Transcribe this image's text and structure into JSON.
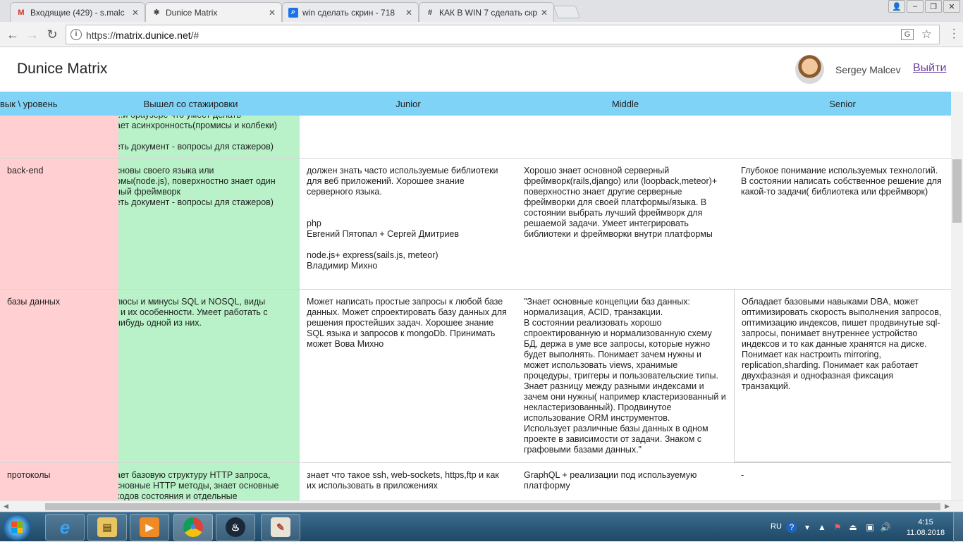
{
  "browser": {
    "tabs": [
      {
        "title": "Входящие (429) - s.malc",
        "icon": "gmail-icon",
        "active": false
      },
      {
        "title": "Dunice Matrix",
        "icon": "react-icon",
        "active": true
      },
      {
        "title": "win сделать скрин - 718",
        "icon": "search-icon",
        "active": false
      },
      {
        "title": "КАК В WIN 7 сделать скр",
        "icon": "hash-icon",
        "active": false
      }
    ],
    "close_glyph": "✕",
    "url_scheme": "https://",
    "url_host": "matrix.dunice.net",
    "url_path": "/#"
  },
  "app": {
    "title": "Dunice Matrix",
    "user_name": "Sergey Malcev",
    "logout_label": "Выйти"
  },
  "table": {
    "headers": [
      "вык \\ уровень",
      "Вышел со стажировки",
      "Junior",
      "Middle",
      "Senior"
    ],
    "rows": [
      {
        "skill": "",
        "intern": "...и браузере что умеет делать\nает асинхронность(промисы и колбеки)\n\nеть документ - вопросы для стажеров)",
        "junior": "",
        "middle": "",
        "senior": ""
      },
      {
        "skill": "back-end",
        "intern": "сновы своего языка или\nрмы(node.js), поверхностно знает один\nный фреймворк\nеть документ - вопросы для стажеров)",
        "junior": "должен знать часто используемые  библиотеки для веб приложений. Хорошее знание серверного языка.\n\n\nphp\nЕвгений Пятопал + Сергей Дмитриев\n\nnode.js+ express(sails.js, meteor)\nВладимир Михно",
        "middle": "Хорошо знает основной серверный фреймворк(rails,django) или (loopback,meteor)+ поверхностно знает другие серверные фреймворки для своей платформы/языка. В состоянии выбрать лучший фреймворк для решаемой задачи. Умеет интегрировать библиотеки и фреймворки внутри платформы",
        "senior": "Глубокое понимание используемых технологий.  В состоянии написать собственное решение для какой-то задачи( библиотека или фреймворк)"
      },
      {
        "skill": "базы данных",
        "intern": "люсы и минусы SQL и NOSQL, виды\n, и их особенности. Умеет работать с\nнибудь одной из них.",
        "junior": "Может написать простые запросы к любой базе данных. Может спроектировать базу данных для решения простейших задач. Хорошее знание SQL языка  и запросов к mongoDb.  Принимать может Вова Михно",
        "middle": "\"Знает основные концепции баз данных: нормализация, ACID, транзакции.\nВ состоянии реализовать хорошо спроектированную и нормализованную схему БД, держа в уме все запросы, которые нужно будет выполнять. Понимает зачем нужны и может использовать  views, хранимые процедуры, триггеры и пользовательские типы.\nЗнает разницу между разными индексами и зачем они нужны( например кластеризованный и некластеризованный). Продвинутое использование ORM инструментов.\nИспользует различные базы данных в одном проекте в зависимости от задачи. Знаком с графовыми базами данных.\"",
        "senior": "Обладает базовыми навыками  DBA, может оптимизировать скорость выполнения запросов, оптимизацию индексов, пишет продвинутые sql-запросы, понимает внутреннее устройство индексов и то как данные хранятся на диске. Понимает как настроить mirroring, replication,sharding. Понимает как работает двухфазная и однофазная фиксация транзакций."
      },
      {
        "skill": "протоколы",
        "intern": "ает  базовую структуру HTTP запроса,\nсновные HTTP методы, знает основные\n кодов состояния и отдельные",
        "junior": "знает что такое ssh, web-sockets, https,ftp и как их использовать в приложениях",
        "middle": "GraphQL + реализации под используемую платформу",
        "senior": "-"
      }
    ]
  },
  "taskbar": {
    "apps": [
      {
        "name": "internet-explorer",
        "glyph": "e"
      },
      {
        "name": "file-explorer",
        "glyph": "▤"
      },
      {
        "name": "media-player",
        "glyph": "▶"
      },
      {
        "name": "chrome",
        "glyph": "●"
      },
      {
        "name": "steam",
        "glyph": "♨"
      },
      {
        "name": "paint",
        "glyph": "✎"
      }
    ],
    "language": "RU",
    "time": "4:15",
    "date": "11.08.2018"
  },
  "colors": {
    "header_bg": "#7fd3f7",
    "skill_col_bg": "#ffcfd2",
    "intern_col_bg": "#b9f2c8",
    "logout_link": "#6b3fa0"
  }
}
